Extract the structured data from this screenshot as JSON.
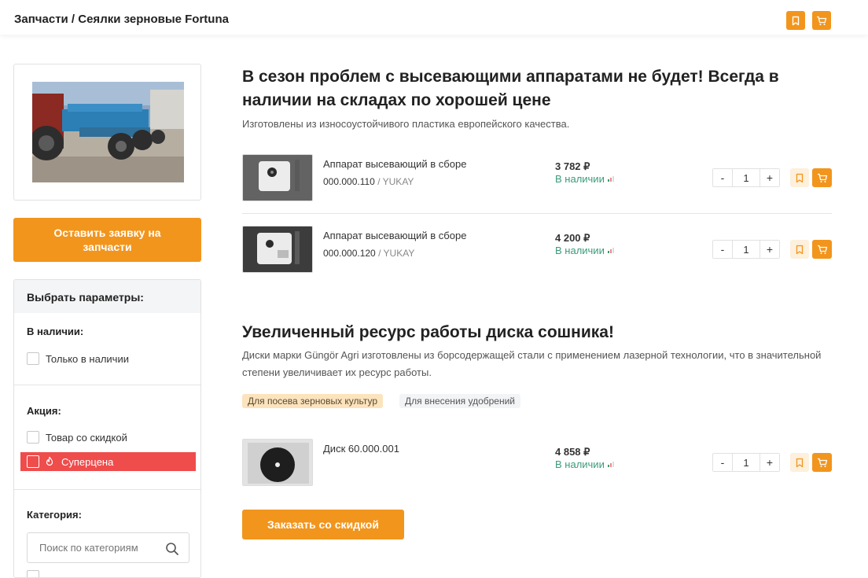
{
  "header": {
    "breadcrumb": "Запчасти / Сеялки зерновые Fortuna",
    "bookmark_icon": "bookmark-icon",
    "cart_icon": "cart-icon",
    "accent": "#f2951d"
  },
  "sidebar": {
    "order_parts_button": "Оставить заявку на запчасти",
    "filters": {
      "title": "Выбрать параметры:",
      "availability": {
        "title": "В наличии:",
        "only_in_stock": "Только в наличии"
      },
      "promo": {
        "title": "Акция:",
        "discounted": "Товар со скидкой",
        "super_price": "Суперцена"
      },
      "category": {
        "title": "Категория:",
        "search_placeholder": "Поиск по категориям"
      }
    }
  },
  "section1": {
    "title": "В сезон проблем с высевающими аппаратами не будет! Всегда в наличии на складах по хорошей цене",
    "subtitle": "Изготовлены из износоустойчивого пластика европейского качества.",
    "products": [
      {
        "name": "Аппарат высевающий в сборе",
        "sku": "000.000.110",
        "brand": "/ YUKAY",
        "price": "3 782 ₽",
        "stock": "В наличии",
        "qty": "1"
      },
      {
        "name": "Аппарат высевающий в сборе",
        "sku": "000.000.120",
        "brand": "/ YUKAY",
        "price": "4 200 ₽",
        "stock": "В наличии",
        "qty": "1"
      }
    ]
  },
  "section2": {
    "title": "Увеличенный ресурс работы диска сошника!",
    "subtitle": "Диски марки Güngör Agri изготовлены из борсодержащей стали с применением лазерной технологии, что в значительной степени увеличивает их ресурс работы.",
    "tags": [
      "Для посева зерновых культур",
      "Для внесения удобрений"
    ],
    "products": [
      {
        "name": "Диск 60.000.001",
        "price": "4 858 ₽",
        "stock": "В наличии",
        "qty": "1"
      }
    ],
    "order_button": "Заказать со скидкой"
  },
  "stepper": {
    "minus": "-",
    "plus": "+"
  },
  "colors": {
    "stock_green": "#3a9b7a",
    "super_red": "#ef4c4c",
    "tag_orange": "#fbe3bd"
  }
}
